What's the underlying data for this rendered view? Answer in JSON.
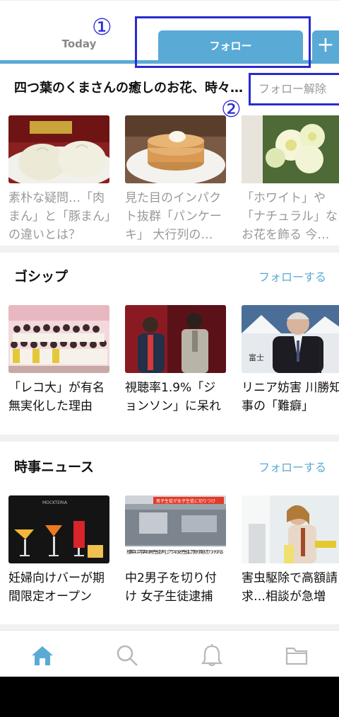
{
  "tabs": {
    "today": "Today",
    "follow": "フォロー",
    "plus": "+"
  },
  "annotations": {
    "one": "①",
    "two": "②"
  },
  "sections": [
    {
      "title": "四つ葉のくまさんの癒しのお花、時々…",
      "action": "フォロー解除",
      "cards": [
        {
          "title": "素朴な疑問…「肉まん」と「豚まん」の違いとは？",
          "read": true
        },
        {
          "title": "見た目のインパクト抜群「パンケーキ」 大行列の…",
          "read": true
        },
        {
          "title": "「ホワイト」や「ナチュラル」なお花を飾る 今…",
          "read": true
        }
      ]
    },
    {
      "title": "ゴシップ",
      "action": "フォローする",
      "cards": [
        {
          "title": "「レコ大」が有名無実化した理由",
          "read": false
        },
        {
          "title": "視聴率1.9%「ジョンソン」に呆れ",
          "read": false
        },
        {
          "title": "リニア妨害 川勝知事の「難癖」",
          "read": false
        }
      ]
    },
    {
      "title": "時事ニュース",
      "action": "フォローする",
      "cards": [
        {
          "title": "妊婦向けバーが期間限定オープン",
          "read": false
        },
        {
          "title": "中2男子を切り付け 女子生徒逮捕",
          "read": false
        },
        {
          "title": "害虫駆除で高額請求…相談が急増",
          "read": false
        }
      ]
    }
  ],
  "thumb_captions": {
    "news2_top": "男子生徒が女子生徒に切りつけ",
    "news2_bottom": "授業中に中学2年の男子生徒が同じクラスの女子生徒に刃物で首を切りつけられる",
    "news1_sign": "MOCKTERIA",
    "gossip3_sign": "富士"
  },
  "colors": {
    "accent": "#5aaad6",
    "annotation": "#2a2ad0",
    "read_text": "#999999"
  },
  "nav": [
    "home-icon",
    "search-icon",
    "bell-icon",
    "folder-icon"
  ]
}
